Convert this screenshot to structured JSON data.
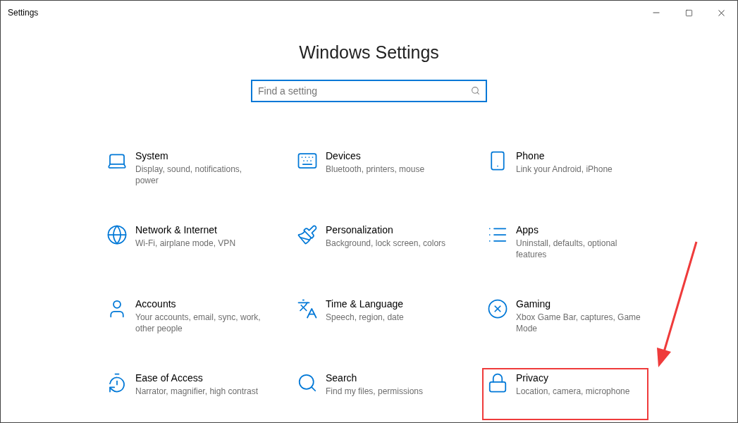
{
  "window": {
    "title": "Settings"
  },
  "heading": "Windows Settings",
  "search": {
    "placeholder": "Find a setting"
  },
  "items": [
    {
      "title": "System",
      "description": "Display, sound, notifications, power",
      "highlighted": false
    },
    {
      "title": "Devices",
      "description": "Bluetooth, printers, mouse",
      "highlighted": false
    },
    {
      "title": "Phone",
      "description": "Link your Android, iPhone",
      "highlighted": false
    },
    {
      "title": "Network & Internet",
      "description": "Wi-Fi, airplane mode, VPN",
      "highlighted": false
    },
    {
      "title": "Personalization",
      "description": "Background, lock screen, colors",
      "highlighted": false
    },
    {
      "title": "Apps",
      "description": "Uninstall, defaults, optional features",
      "highlighted": false
    },
    {
      "title": "Accounts",
      "description": "Your accounts, email, sync, work, other people",
      "highlighted": false
    },
    {
      "title": "Time & Language",
      "description": "Speech, region, date",
      "highlighted": false
    },
    {
      "title": "Gaming",
      "description": "Xbox Game Bar, captures, Game Mode",
      "highlighted": false
    },
    {
      "title": "Ease of Access",
      "description": "Narrator, magnifier, high contrast",
      "highlighted": false
    },
    {
      "title": "Search",
      "description": "Find my files, permissions",
      "highlighted": false
    },
    {
      "title": "Privacy",
      "description": "Location, camera, microphone",
      "highlighted": true
    }
  ]
}
